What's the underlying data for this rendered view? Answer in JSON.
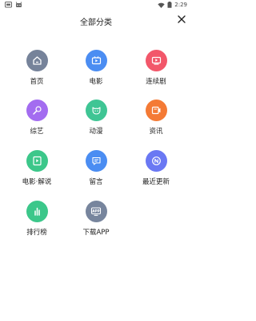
{
  "status_bar": {
    "time": "2:29",
    "icons": [
      "notification-icon",
      "robot-icon",
      "wifi-icon",
      "battery-icon"
    ]
  },
  "header": {
    "title": "全部分类",
    "close_icon": "close-icon"
  },
  "categories": [
    {
      "label": "首页",
      "icon": "home-icon",
      "color": "#76839a"
    },
    {
      "label": "电影",
      "icon": "movie-icon",
      "color": "#4b8df2"
    },
    {
      "label": "连续剧",
      "icon": "tv-series-icon",
      "color": "#f2576a"
    },
    {
      "label": "综艺",
      "icon": "microphone-icon",
      "color": "#a36cf0"
    },
    {
      "label": "动漫",
      "icon": "anime-cat-icon",
      "color": "#3fc594"
    },
    {
      "label": "资讯",
      "icon": "news-video-icon",
      "color": "#f47a35"
    },
    {
      "label": "电影·解说",
      "icon": "play-list-icon",
      "color": "#3cc78a"
    },
    {
      "label": "留言",
      "icon": "message-icon",
      "color": "#4b8df2"
    },
    {
      "label": "最近更新",
      "icon": "new-badge-icon",
      "color": "#6a78f3"
    },
    {
      "label": "排行榜",
      "icon": "bar-chart-icon",
      "color": "#3cc78a"
    },
    {
      "label": "下载APP",
      "icon": "app-download-icon",
      "color": "#77859d"
    }
  ]
}
